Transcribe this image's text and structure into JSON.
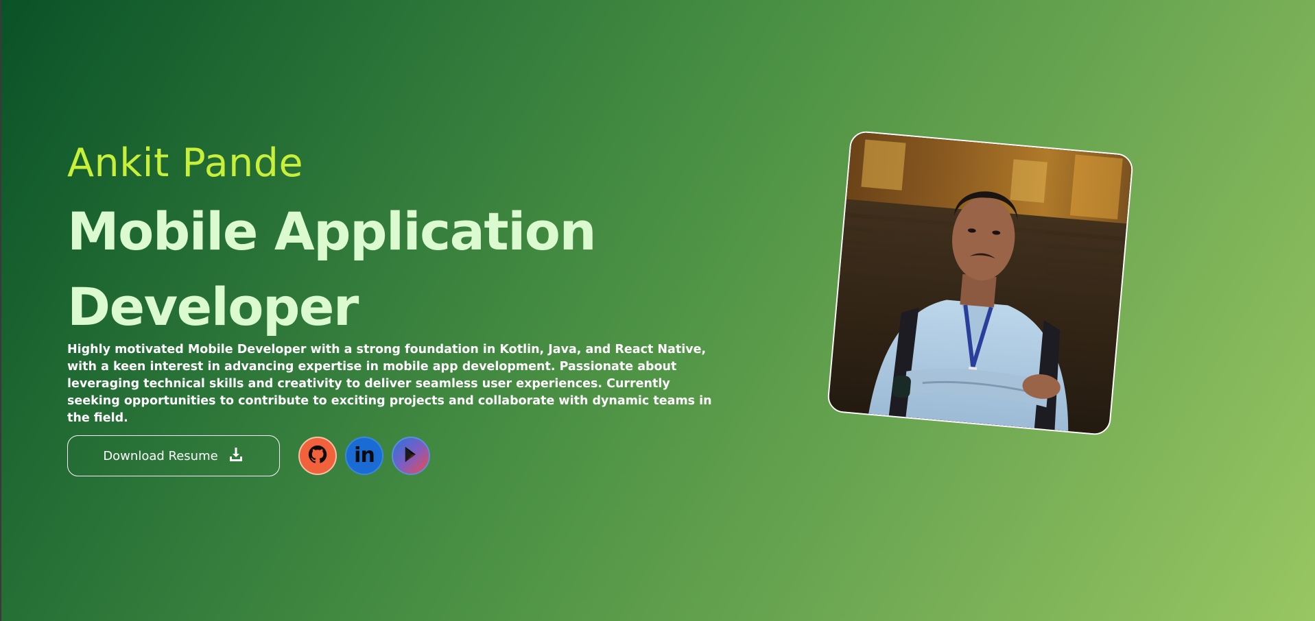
{
  "hero": {
    "name": "Ankit Pande",
    "title": "Mobile Application Developer",
    "description": "Highly motivated Mobile Developer with a strong foundation in Kotlin, Java, and React Native, with a keen interest in advancing expertise in mobile app development. Passionate about leveraging technical skills and creativity to deliver seamless user experiences. Currently seeking opportunities to contribute to exciting projects and collaborate with dynamic teams in the field."
  },
  "actions": {
    "resume_label": "Download Resume",
    "resume_icon": "download-icon"
  },
  "socials": [
    {
      "name": "GitHub",
      "icon": "github-icon",
      "color": "#f0613c"
    },
    {
      "name": "LinkedIn",
      "icon": "linkedin-icon",
      "color": "#1a6bd4",
      "glyph": "in"
    },
    {
      "name": "Google Play",
      "icon": "play-store-icon",
      "color": "#7b5ec4"
    }
  ],
  "profile_photo": {
    "icon": "profile-photo"
  },
  "colors": {
    "name_accent": "#c8f03a",
    "title": "#dcfad0",
    "background_start": "#0a5227",
    "background_end": "#98c662"
  }
}
